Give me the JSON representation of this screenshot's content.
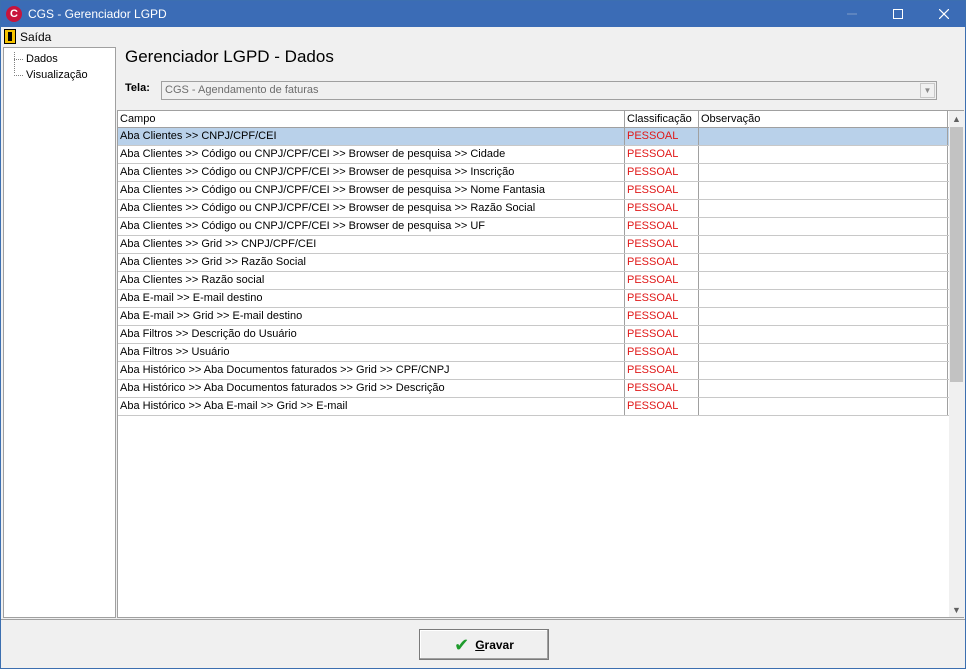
{
  "window": {
    "title": "CGS - Gerenciador LGPD",
    "icon": "app-logo-icon"
  },
  "menu": {
    "exit_label": "Saída"
  },
  "sidebar": {
    "items": [
      {
        "label": "Dados"
      },
      {
        "label": "Visualização"
      }
    ]
  },
  "main": {
    "title": "Gerenciador LGPD - Dados",
    "tela_label": "Tela:",
    "tela_value": "CGS - Agendamento de faturas"
  },
  "grid": {
    "columns": [
      "Campo",
      "Classificação",
      "Observação"
    ],
    "rows": [
      {
        "campo": "Aba Clientes >> CNPJ/CPF/CEI",
        "classificacao": "PESSOAL",
        "observacao": ""
      },
      {
        "campo": "Aba Clientes >> Código ou CNPJ/CPF/CEI >> Browser de pesquisa >> Cidade",
        "classificacao": "PESSOAL",
        "observacao": ""
      },
      {
        "campo": "Aba Clientes >> Código ou CNPJ/CPF/CEI >> Browser de pesquisa >> Inscrição",
        "classificacao": "PESSOAL",
        "observacao": ""
      },
      {
        "campo": "Aba Clientes >> Código ou CNPJ/CPF/CEI >> Browser de pesquisa >> Nome Fantasia",
        "classificacao": "PESSOAL",
        "observacao": ""
      },
      {
        "campo": "Aba Clientes >> Código ou CNPJ/CPF/CEI >> Browser de pesquisa >> Razão Social",
        "classificacao": "PESSOAL",
        "observacao": ""
      },
      {
        "campo": "Aba Clientes >> Código ou CNPJ/CPF/CEI >> Browser de pesquisa >> UF",
        "classificacao": "PESSOAL",
        "observacao": ""
      },
      {
        "campo": "Aba Clientes >> Grid >> CNPJ/CPF/CEI",
        "classificacao": "PESSOAL",
        "observacao": ""
      },
      {
        "campo": "Aba Clientes >> Grid >> Razão Social",
        "classificacao": "PESSOAL",
        "observacao": ""
      },
      {
        "campo": "Aba Clientes >> Razão social",
        "classificacao": "PESSOAL",
        "observacao": ""
      },
      {
        "campo": "Aba E-mail >> E-mail destino",
        "classificacao": "PESSOAL",
        "observacao": ""
      },
      {
        "campo": "Aba E-mail >> Grid >> E-mail destino",
        "classificacao": "PESSOAL",
        "observacao": ""
      },
      {
        "campo": "Aba Filtros >> Descrição do Usuário",
        "classificacao": "PESSOAL",
        "observacao": ""
      },
      {
        "campo": "Aba Filtros >> Usuário",
        "classificacao": "PESSOAL",
        "observacao": ""
      },
      {
        "campo": "Aba Histórico >> Aba Documentos faturados >> Grid >> CPF/CNPJ",
        "classificacao": "PESSOAL",
        "observacao": ""
      },
      {
        "campo": "Aba Histórico >> Aba Documentos faturados >> Grid >> Descrição",
        "classificacao": "PESSOAL",
        "observacao": ""
      },
      {
        "campo": "Aba Histórico >> Aba E-mail >> Grid >> E-mail",
        "classificacao": "PESSOAL",
        "observacao": ""
      }
    ],
    "selected_row": 0
  },
  "footer": {
    "save_label": "Gravar"
  },
  "colors": {
    "titlebar": "#3b6cb6",
    "selected_row": "#b9d1ea",
    "classification_text": "#e01818",
    "save_check": "#1e9b2c"
  }
}
